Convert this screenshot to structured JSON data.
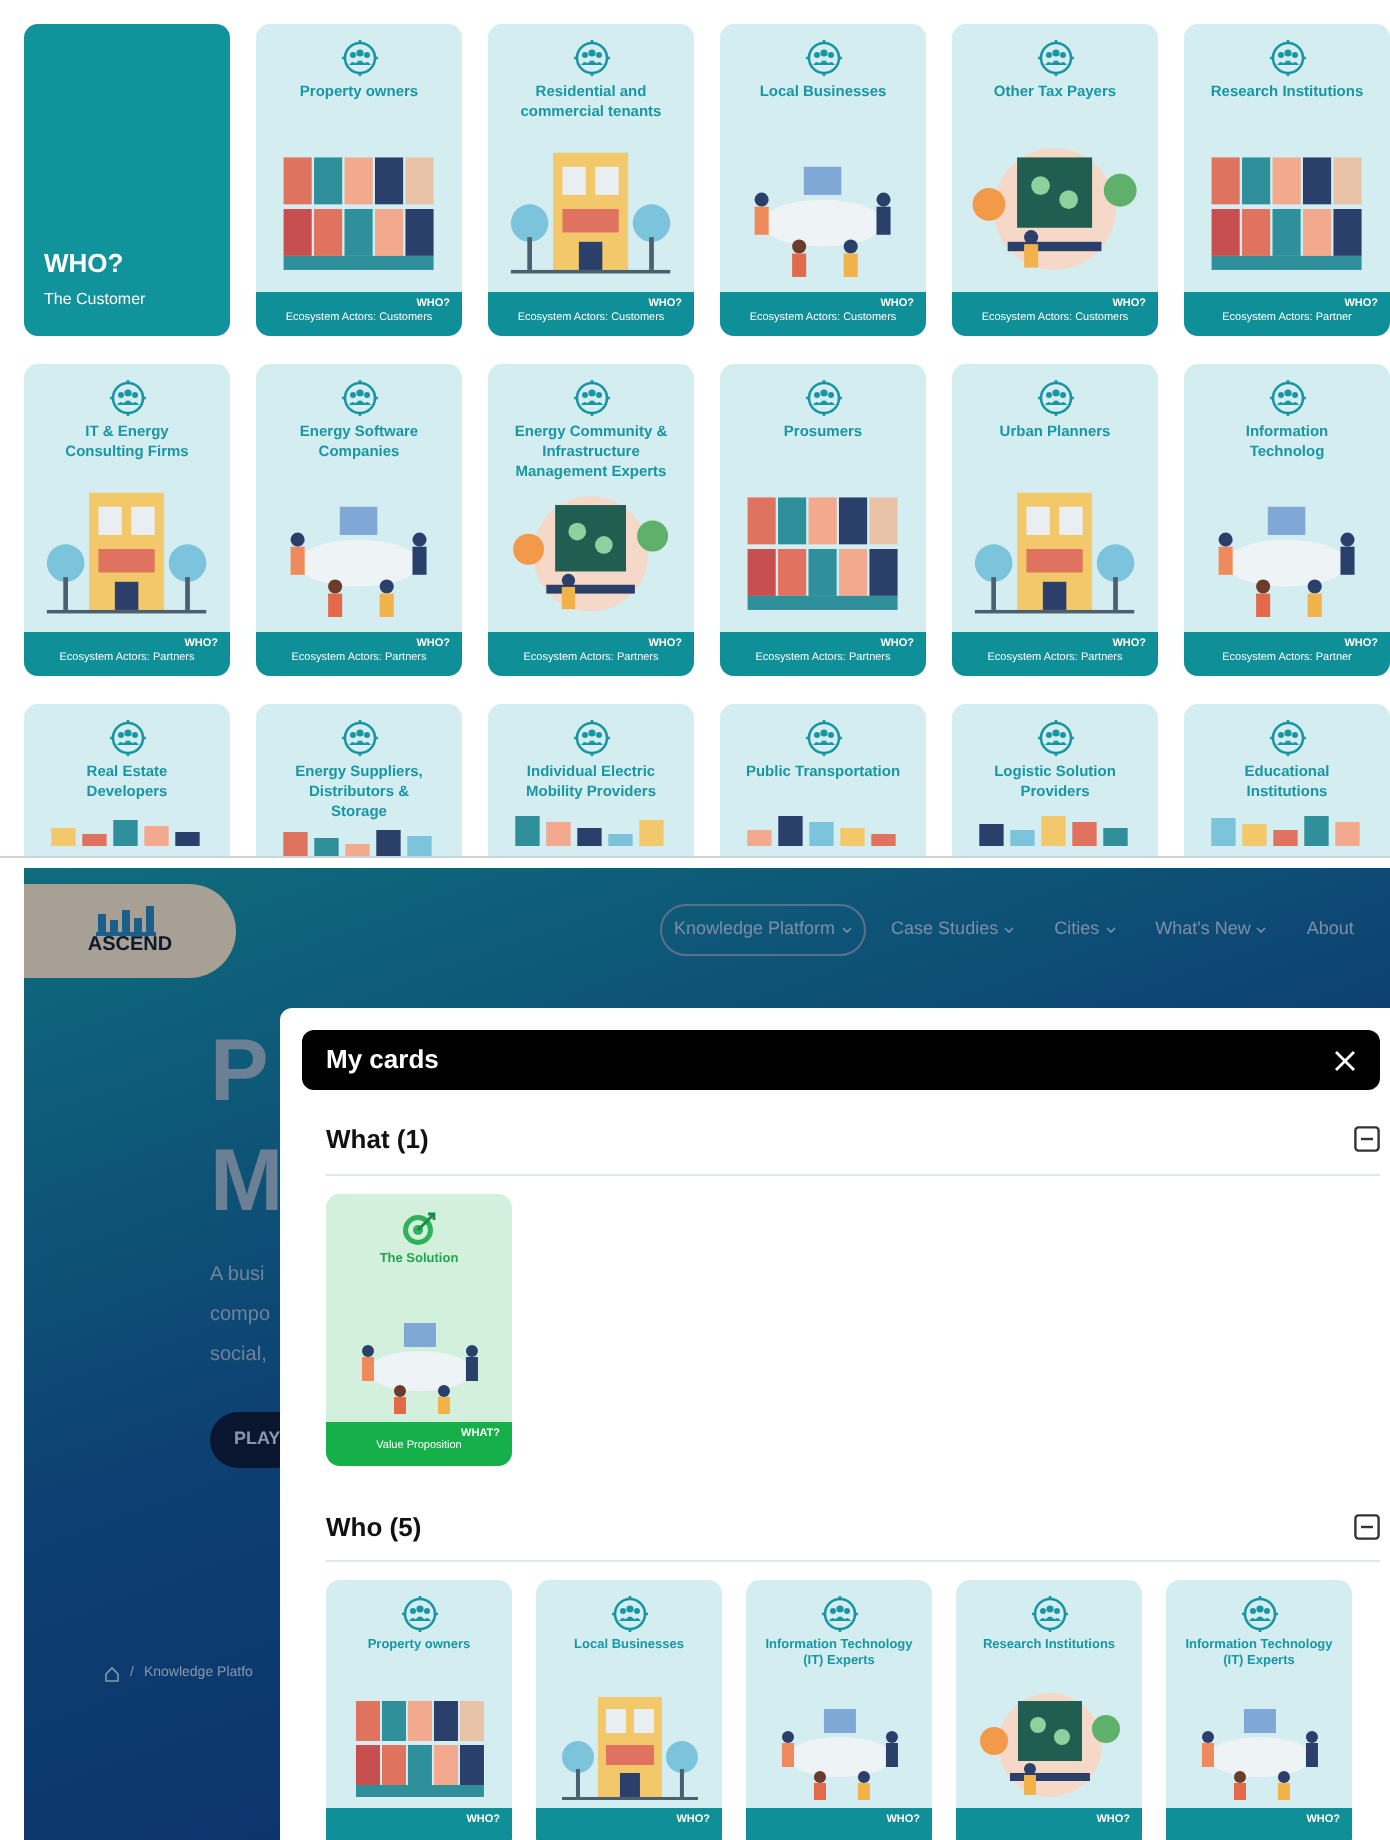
{
  "deck": {
    "intro": {
      "heading": "WHO?",
      "subheading": "The Customer"
    },
    "cards": [
      {
        "title": "Property owners",
        "category": "WHO?",
        "subtitle": "Ecosystem Actors: Customers"
      },
      {
        "title": "Residential and commercial tenants",
        "category": "WHO?",
        "subtitle": "Ecosystem Actors: Customers"
      },
      {
        "title": "Local Businesses",
        "category": "WHO?",
        "subtitle": "Ecosystem Actors: Customers"
      },
      {
        "title": "Other Tax Payers",
        "category": "WHO?",
        "subtitle": "Ecosystem Actors: Customers"
      },
      {
        "title": "Research Institutions",
        "category": "WHO?",
        "subtitle": "Ecosystem Actors: Partner"
      },
      {
        "title": "IT & Energy Consulting Firms",
        "category": "WHO?",
        "subtitle": "Ecosystem Actors: Partners"
      },
      {
        "title": "Energy Software Companies",
        "category": "WHO?",
        "subtitle": "Ecosystem Actors: Partners"
      },
      {
        "title": "Energy Community & Infrastructure Management Experts",
        "category": "WHO?",
        "subtitle": "Ecosystem Actors: Partners"
      },
      {
        "title": "Prosumers",
        "category": "WHO?",
        "subtitle": "Ecosystem Actors: Partners"
      },
      {
        "title": "Urban Planners",
        "category": "WHO?",
        "subtitle": "Ecosystem Actors: Partners"
      },
      {
        "title": "Information Technolog",
        "category": "WHO?",
        "subtitle": "Ecosystem Actors: Partner"
      },
      {
        "title": "Real Estate Developers"
      },
      {
        "title": "Energy Suppliers, Distributors & Storage"
      },
      {
        "title": "Individual Electric Mobility Providers"
      },
      {
        "title": "Public Transportation"
      },
      {
        "title": "Logistic Solution Providers"
      },
      {
        "title": "Educational Institutions"
      }
    ]
  },
  "site": {
    "logo": "ASCEND",
    "nav": [
      {
        "label": "Knowledge Platform",
        "selected": true
      },
      {
        "label": "Case Studies",
        "selected": false
      },
      {
        "label": "Cities",
        "selected": false
      },
      {
        "label": "What's New",
        "selected": false
      },
      {
        "label": "About",
        "selected": false
      }
    ],
    "hero": {
      "title_lines": [
        "P",
        "M"
      ],
      "text_lines": [
        "A busi",
        "compo",
        "social,"
      ],
      "button": "PLAY"
    },
    "breadcrumb": {
      "separator": "/",
      "current": "Knowledge Platfo"
    }
  },
  "modal": {
    "title": "My cards",
    "sections": [
      {
        "heading": "What (1)",
        "expanded": true,
        "cards": [
          {
            "kind": "what",
            "title": "The Solution",
            "category": "WHAT?",
            "subtitle": "Value Proposition"
          }
        ]
      },
      {
        "heading": "Who (5)",
        "expanded": true,
        "cards": [
          {
            "kind": "who",
            "title": "Property owners",
            "category": "WHO?"
          },
          {
            "kind": "who",
            "title": "Local Businesses",
            "category": "WHO?"
          },
          {
            "kind": "who",
            "title": "Information Technology (IT) Experts",
            "category": "WHO?"
          },
          {
            "kind": "who",
            "title": "Research Institutions",
            "category": "WHO?"
          },
          {
            "kind": "who",
            "title": "Information Technology (IT) Experts",
            "category": "WHO?"
          }
        ]
      }
    ]
  }
}
